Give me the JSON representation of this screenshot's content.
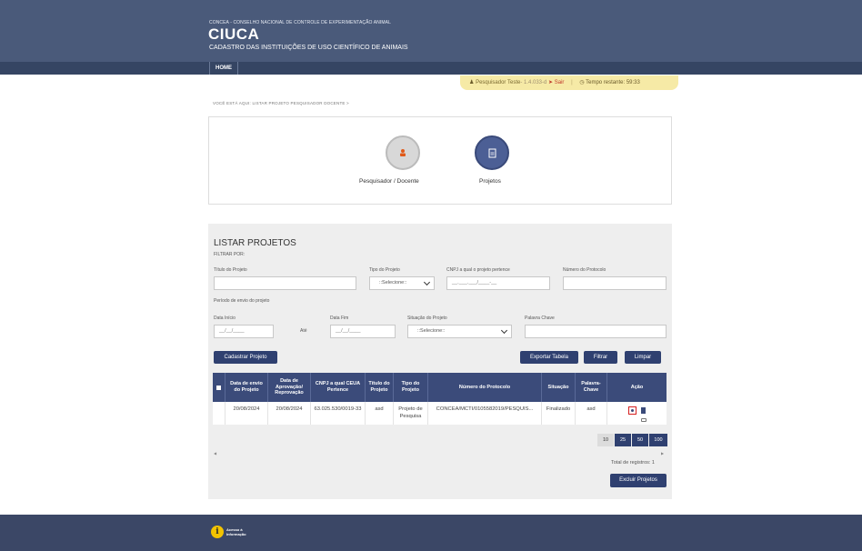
{
  "header": {
    "subtitle": "CONCEA - CONSELHO NACIONAL DE CONTROLE DE EXPERIMENTAÇÃO ANIMAL",
    "title": "CIUCA",
    "tagline": "CADASTRO DAS INSTITUIÇÕES DE USO CIENTÍFICO DE ANIMAIS"
  },
  "nav": {
    "home": "HOME"
  },
  "userbar": {
    "user": "Pesquisador Teste",
    "version": "- 1.4.033-d",
    "logout": "Sair",
    "separator": "|",
    "timer": "Tempo restante: 59:33"
  },
  "breadcrumb": "VOCÊ ESTÁ AQUI: LISTAR PROJETO PESQUISADOR DOCENTE >",
  "cards": [
    {
      "label": "Pesquisador / Docente",
      "icon": "person-icon"
    },
    {
      "label": "Projetos",
      "icon": "document-icon"
    }
  ],
  "panel": {
    "title": "LISTAR PROJETOS",
    "filter_by": "FILTRAR POR:",
    "labels": {
      "titulo": "Título do Projeto",
      "tipo": "Tipo do Projeto",
      "cnpj": "CNPJ a qual o projeto pertence",
      "protocolo": "Número do Protocolo",
      "periodo": "Período de envio do projeto",
      "data_inicio": "Data Início",
      "ate": "Até",
      "data_fim": "Data Fim",
      "situacao": "Situação do Projeto",
      "palavra": "Palavra Chave"
    },
    "inputs": {
      "tipo_selected": "::Selecione::",
      "cnpj_placeholder": "__.___.___/____-__",
      "data_inicio_placeholder": "__/__/____",
      "data_fim_placeholder": "__/__/____",
      "situacao_selected": "::Selecione::"
    },
    "buttons": {
      "cadastrar": "Cadastrar Projeto",
      "exportar": "Exportar Tabela",
      "filtrar": "Filtrar",
      "limpar": "Limpar",
      "excluir": "Excluir Projetos"
    }
  },
  "table": {
    "headers": [
      "Data de envio do Projeto",
      "Data de Aprovação/ Reprovação",
      "CNPJ a qual CEUA Pertence",
      "Título do Projeto",
      "Tipo do Projeto",
      "Número do Protocolo",
      "Situação",
      "Palavra-Chave",
      "Ação"
    ],
    "rows": [
      {
        "envio": "20/08/2024",
        "aprovacao": "20/08/2024",
        "cnpj": "63.025.530/0019-33",
        "titulo": "asd",
        "tipo": "Projeto de Pesquisa",
        "protocolo": "CONCEA/MCTI/0105582019/PESQUIS...",
        "situacao": "Finalizado",
        "palavra": "asd"
      }
    ],
    "page_sizes": [
      "10",
      "25",
      "50",
      "100"
    ],
    "selected_page_size": "10",
    "total": "Total de registros: 1"
  },
  "footer": {
    "info_line1": "Acesso à",
    "info_line2": "Informação"
  },
  "colors": {
    "header": "#4a5a7a",
    "primary": "#2f4070",
    "userbar": "#f6eaa6"
  }
}
